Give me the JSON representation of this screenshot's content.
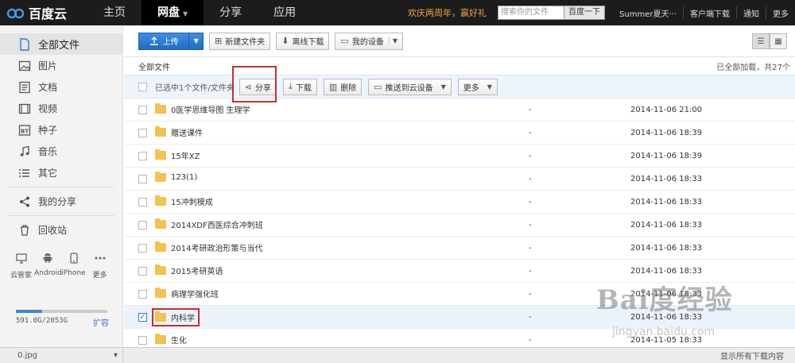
{
  "logo": {
    "name": "百度云"
  },
  "nav": {
    "items": [
      {
        "label": "主页",
        "active": false
      },
      {
        "label": "网盘",
        "active": true
      },
      {
        "label": "分享",
        "active": false
      },
      {
        "label": "应用",
        "active": false
      }
    ]
  },
  "top_right": {
    "promo": "欢庆两周年，赢好礼",
    "search_placeholder": "搜索你的文件",
    "search_button": "百度一下",
    "user": "Summer夏天···",
    "client_download": "客户端下载",
    "notify": "通知",
    "more": "更多"
  },
  "sidebar": {
    "items": [
      {
        "label": "全部文件",
        "icon": "file-icon",
        "active": true
      },
      {
        "label": "图片",
        "icon": "image-icon"
      },
      {
        "label": "文档",
        "icon": "document-icon"
      },
      {
        "label": "视频",
        "icon": "video-icon"
      },
      {
        "label": "种子",
        "icon": "bt-icon"
      },
      {
        "label": "音乐",
        "icon": "music-icon"
      },
      {
        "label": "其它",
        "icon": "other-icon"
      }
    ],
    "my_share": "我的分享",
    "recycle": "回收站",
    "devices": [
      {
        "label": "云管家",
        "icon": "monitor-icon"
      },
      {
        "label": "Android",
        "icon": "android-icon"
      },
      {
        "label": "iPhone",
        "icon": "phone-icon"
      },
      {
        "label": "更多",
        "icon": "more-icon"
      }
    ],
    "quota_text": "591.0G/2053G",
    "quota_fraction": 0.288,
    "expand": "扩容"
  },
  "toolbar": {
    "upload": "上传",
    "new_folder": "新建文件夹",
    "offline_download": "离线下载",
    "my_device": "我的设备"
  },
  "crumb": {
    "path": "全部文件",
    "loaded": "已全部加载，共27个"
  },
  "action_bar": {
    "selected_text": "已选中1个文件/文件夹",
    "share": "分享",
    "download": "下载",
    "delete": "删除",
    "push": "推送到云设备",
    "more": "更多"
  },
  "files": [
    {
      "name": "0医学思维导图 生理学",
      "size": "-",
      "date": "2014-11-06 21:00",
      "selected": false
    },
    {
      "name": "赠送课件",
      "size": "-",
      "date": "2014-11-06 18:39",
      "selected": false
    },
    {
      "name": "15年XZ",
      "size": "-",
      "date": "2014-11-06 18:39",
      "selected": false
    },
    {
      "name": "123(1)",
      "size": "-",
      "date": "2014-11-06 18:33",
      "selected": false
    },
    {
      "name": "15冲刺模成",
      "size": "-",
      "date": "2014-11-06 18:33",
      "selected": false
    },
    {
      "name": "2014XDF西医综合冲刺班",
      "size": "-",
      "date": "2014-11-06 18:33",
      "selected": false
    },
    {
      "name": "2014考研政治形策与当代",
      "size": "-",
      "date": "2014-11-06 18:33",
      "selected": false
    },
    {
      "name": "2015考研英语",
      "size": "-",
      "date": "2014-11-06 18:33",
      "selected": false
    },
    {
      "name": "病理学强化班",
      "size": "-",
      "date": "2014-11-06 18:33",
      "selected": false
    },
    {
      "name": "内科学",
      "size": "-",
      "date": "2014-11-06 18:33",
      "selected": true
    },
    {
      "name": "生化",
      "size": "-",
      "date": "2014-11-05 18:33",
      "selected": false
    }
  ],
  "bottom": {
    "download_file": "0.jpg",
    "right_text": "显示所有下载内容"
  },
  "watermark": {
    "main": "Bai度经验",
    "sub": "jingyan.baidu.com"
  }
}
